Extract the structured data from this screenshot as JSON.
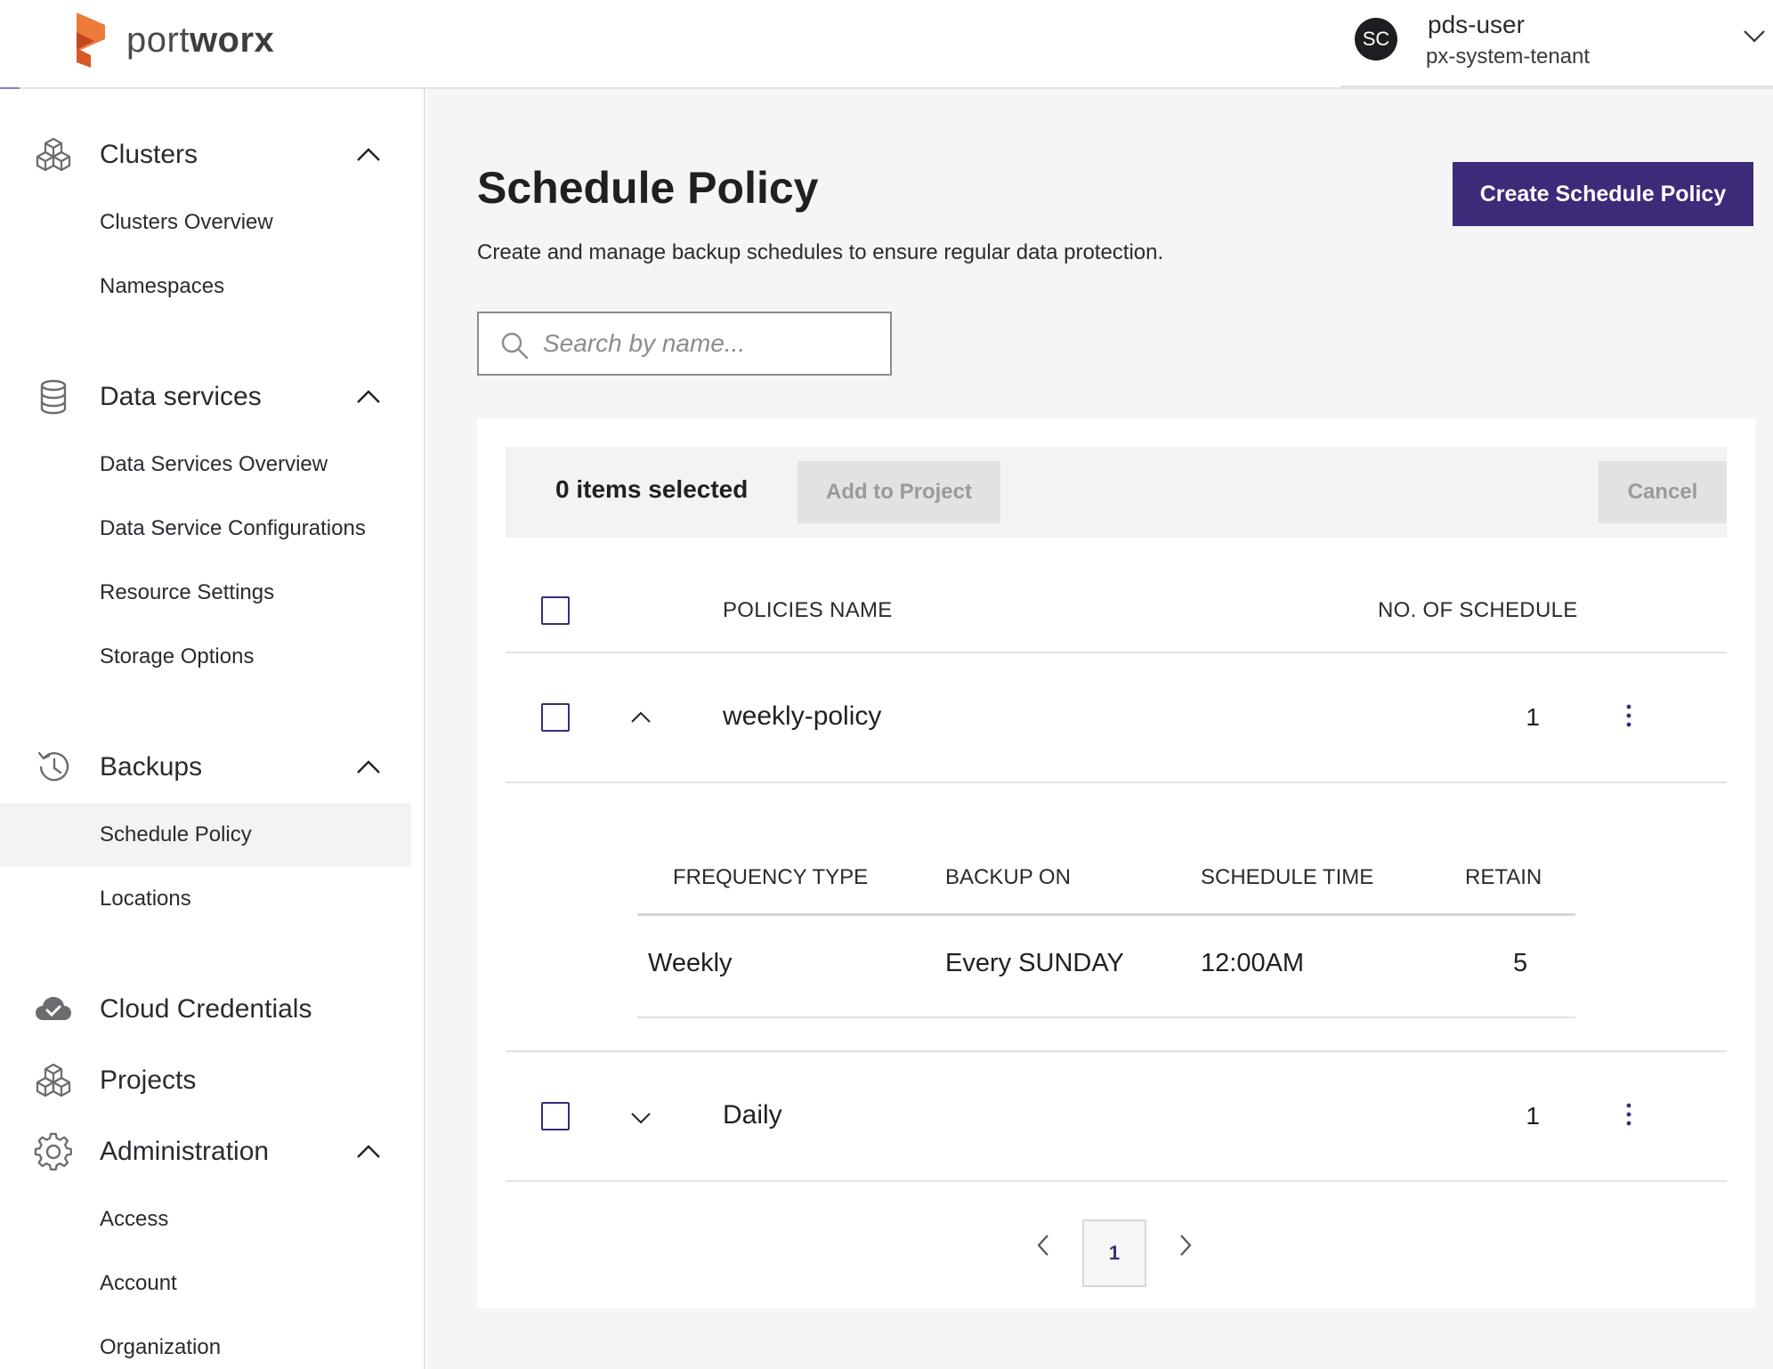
{
  "header": {
    "logo": {
      "text_light": "port",
      "text_bold": "worx",
      "color": "#e4642c"
    },
    "user": {
      "initials": "SC",
      "name": "pds-user",
      "tenant": "px-system-tenant"
    }
  },
  "sidebar": {
    "sections": [
      {
        "label": "Clusters",
        "icon": "cubes-icon",
        "expanded": true,
        "items": [
          "Clusters Overview",
          "Namespaces"
        ]
      },
      {
        "label": "Data services",
        "icon": "database-icon",
        "expanded": true,
        "items": [
          "Data Services Overview",
          "Data Service Configurations",
          "Resource Settings",
          "Storage Options"
        ]
      },
      {
        "label": "Backups",
        "icon": "history-icon",
        "expanded": true,
        "items": [
          "Schedule Policy",
          "Locations"
        ],
        "active_item": "Schedule Policy"
      },
      {
        "label": "Cloud Credentials",
        "icon": "cloud-check-icon"
      },
      {
        "label": "Projects",
        "icon": "cubes-icon"
      },
      {
        "label": "Administration",
        "icon": "gear-icon",
        "expanded": true,
        "items": [
          "Access",
          "Account",
          "Organization"
        ]
      }
    ]
  },
  "main": {
    "title": "Schedule Policy",
    "description": "Create and manage backup schedules to ensure regular data protection.",
    "create_button": "Create Schedule Policy",
    "search": {
      "placeholder": "Search by name..."
    },
    "selection": {
      "count_label": "0 items selected",
      "add_button": "Add to Project",
      "cancel_button": "Cancel"
    },
    "table": {
      "columns": [
        "POLICIES NAME",
        "NO. OF SCHEDULE"
      ],
      "rows": [
        {
          "name": "weekly-policy",
          "schedules": "1",
          "expanded": true,
          "detail": {
            "columns": [
              "FREQUENCY TYPE",
              "BACKUP ON",
              "SCHEDULE TIME",
              "RETAIN"
            ],
            "rows": [
              {
                "frequency": "Weekly",
                "backup_on": "Every SUNDAY",
                "time": "12:00AM",
                "retain": "5"
              }
            ]
          }
        },
        {
          "name": "Daily",
          "schedules": "1",
          "expanded": false
        }
      ]
    },
    "pagination": {
      "current_page": "1"
    }
  },
  "colors": {
    "primary": "#3d2a78",
    "background": "#f5f5f5"
  }
}
